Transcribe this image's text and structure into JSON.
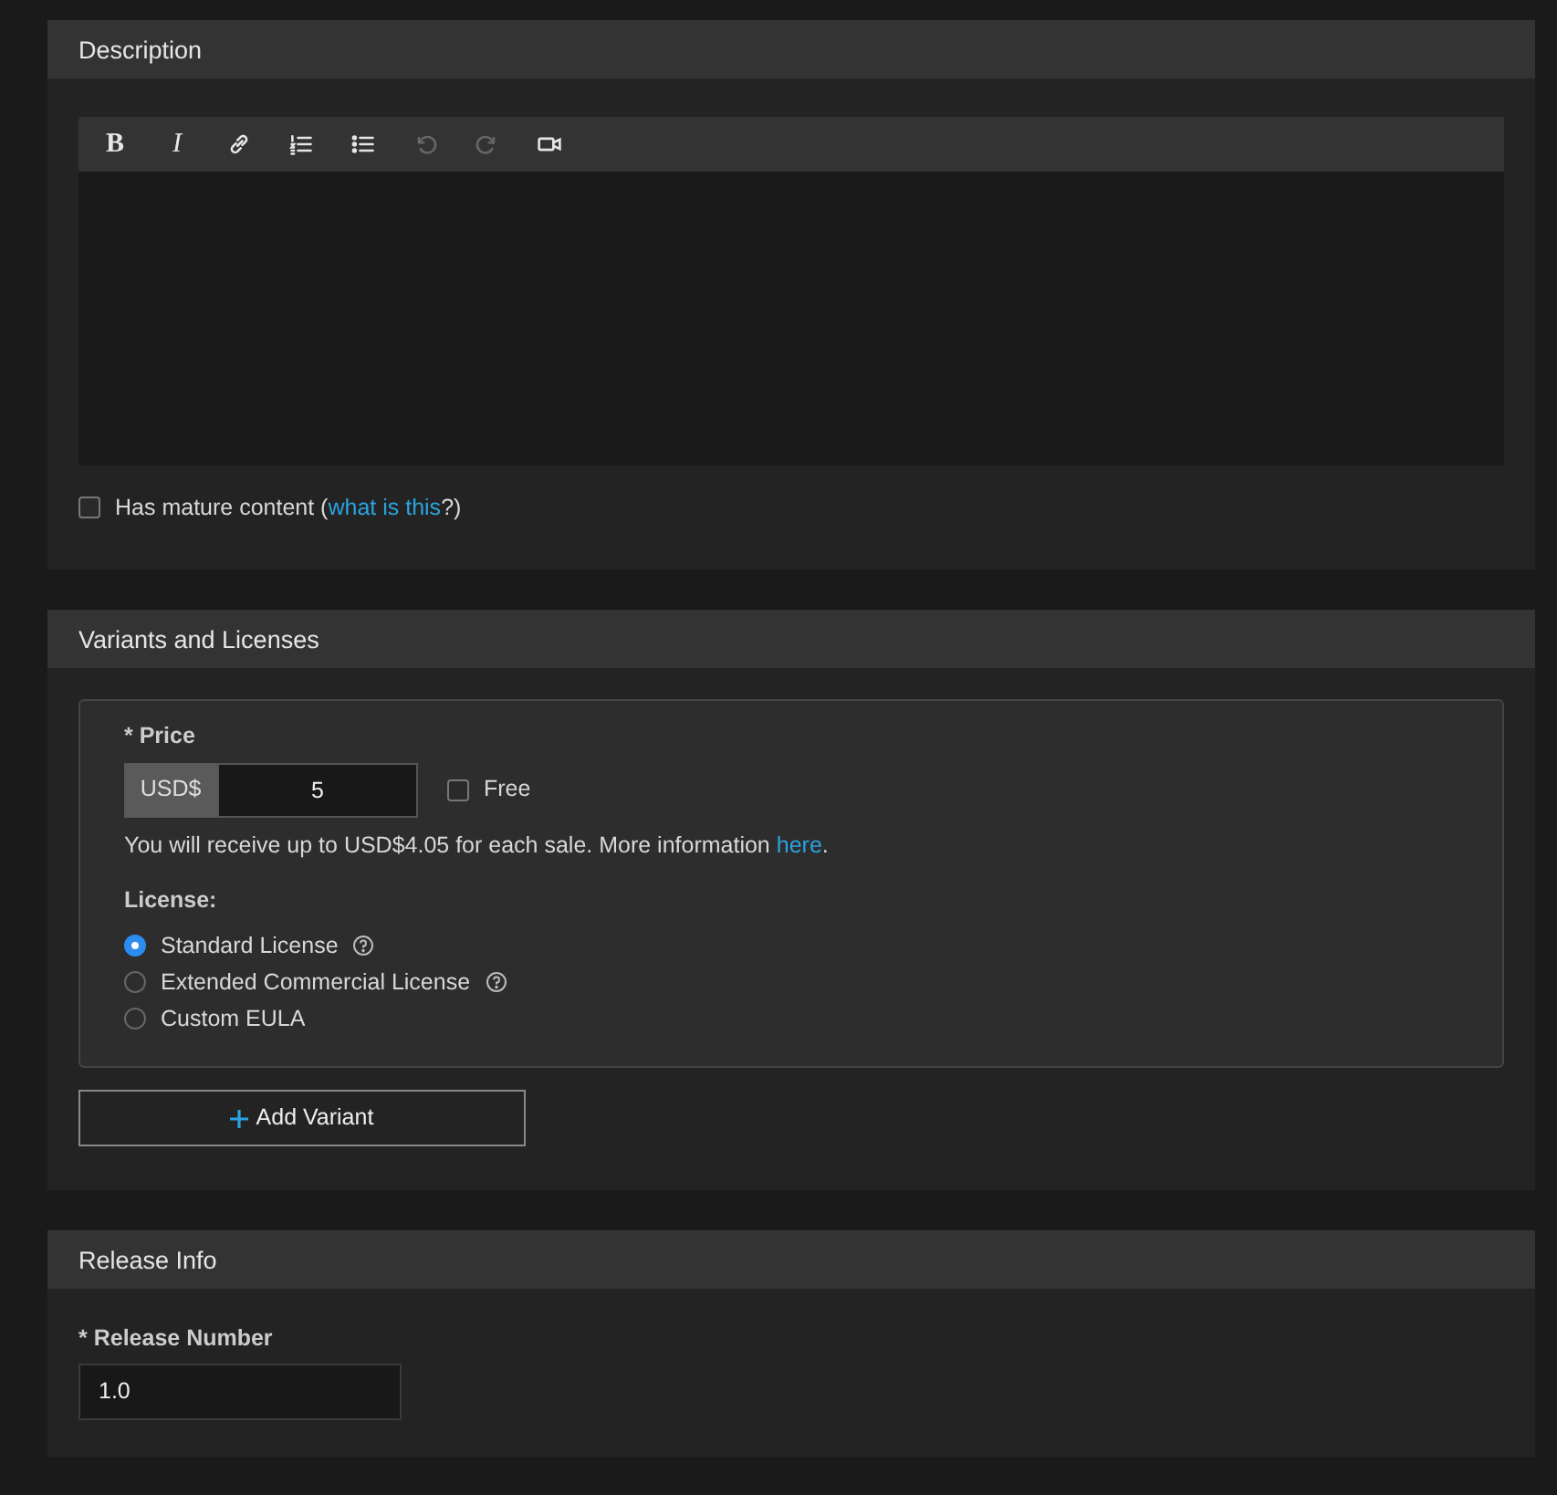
{
  "description": {
    "title": "Description",
    "toolbar": [
      {
        "kind": "bold",
        "label": "B",
        "disabled": false
      },
      {
        "kind": "italic",
        "label": "I",
        "disabled": false
      },
      {
        "kind": "link",
        "disabled": false
      },
      {
        "kind": "ordered-list",
        "disabled": false
      },
      {
        "kind": "bullet-list",
        "disabled": false
      },
      {
        "kind": "undo",
        "disabled": true
      },
      {
        "kind": "redo",
        "disabled": true
      },
      {
        "kind": "video",
        "disabled": false
      }
    ],
    "mature": {
      "checked": false,
      "text_before": "Has mature content (",
      "link": "what is this",
      "text_after": "?)"
    }
  },
  "variants": {
    "title": "Variants and Licenses",
    "price_label": "* Price",
    "currency": "USD$",
    "price": "5",
    "free": {
      "label": "Free",
      "checked": false
    },
    "note": {
      "text_before": "You will receive up to USD$4.05 for each sale. More information ",
      "link": "here",
      "text_after": "."
    },
    "license_label": "License:",
    "licenses": [
      {
        "label": "Standard License",
        "selected": true,
        "help": true
      },
      {
        "label": "Extended Commercial License",
        "selected": false,
        "help": true
      },
      {
        "label": "Custom EULA",
        "selected": false,
        "help": false
      }
    ],
    "add_button": "Add Variant"
  },
  "release": {
    "title": "Release Info",
    "label": "* Release Number",
    "value": "1.0"
  }
}
